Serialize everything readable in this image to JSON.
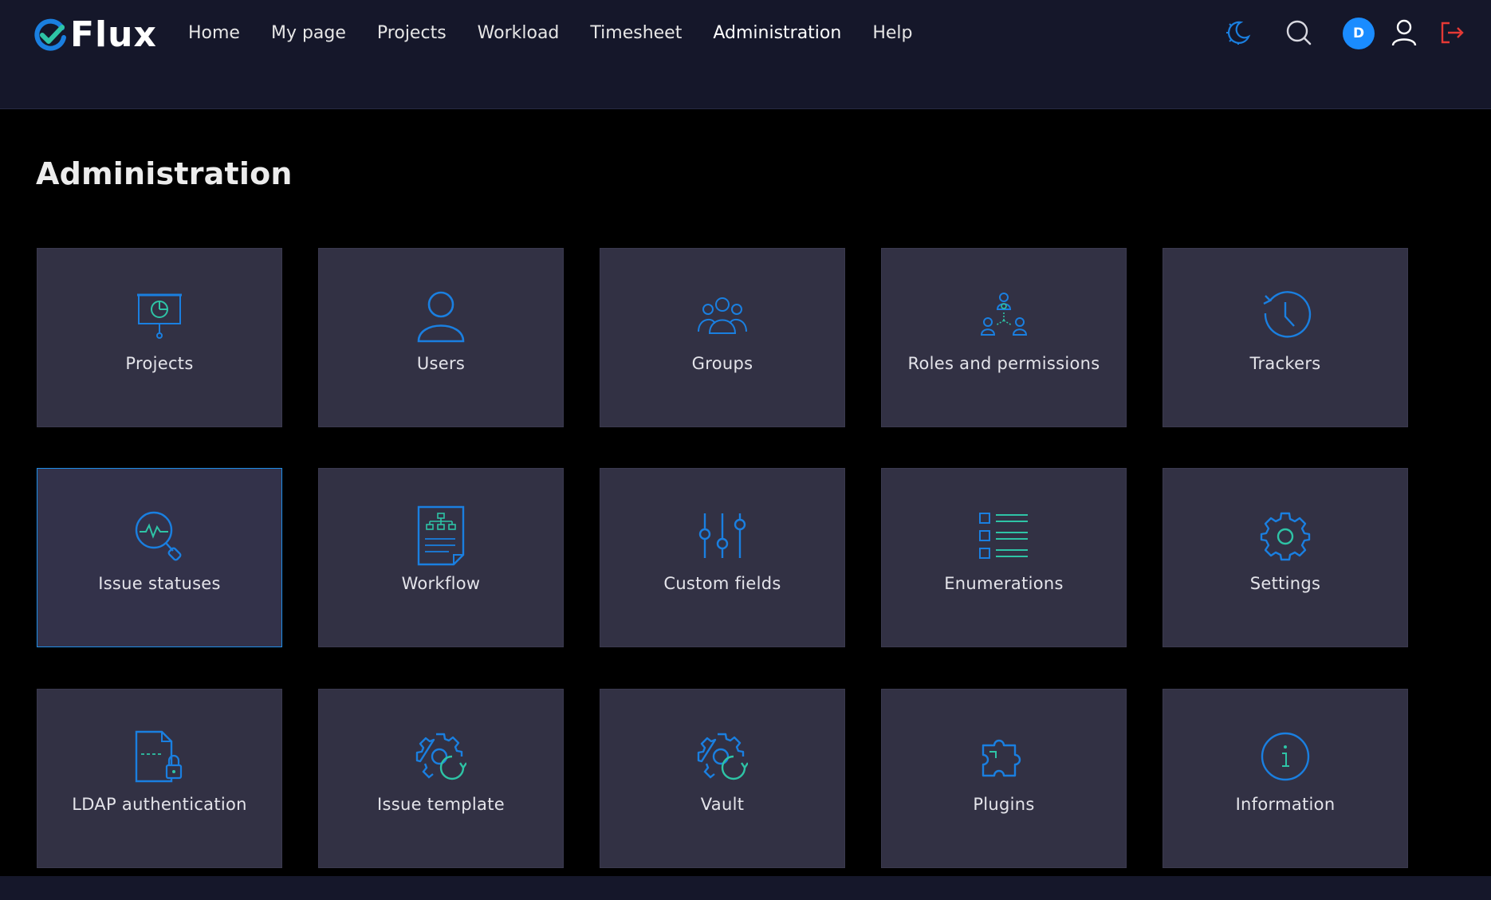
{
  "app": {
    "name": "Flux"
  },
  "nav": {
    "items": [
      {
        "label": "Home"
      },
      {
        "label": "My page"
      },
      {
        "label": "Projects"
      },
      {
        "label": "Workload"
      },
      {
        "label": "Timesheet"
      },
      {
        "label": "Administration",
        "active": true
      },
      {
        "label": "Help"
      }
    ]
  },
  "topbar": {
    "icons": [
      "theme-toggle-icon",
      "search-icon",
      "user-icon",
      "logout-icon"
    ],
    "avatar_initial": "D"
  },
  "colors": {
    "accent": "#1f8ee8",
    "icon_blue": "#1a7fe0",
    "icon_green": "#2ec4a6",
    "logout_red": "#e53935",
    "card_bg": "#323144",
    "topbar_bg": "#15172a"
  },
  "page": {
    "title": "Administration"
  },
  "cards": [
    {
      "label": "Projects",
      "icon": "presentation-board-icon"
    },
    {
      "label": "Users",
      "icon": "user-icon"
    },
    {
      "label": "Groups",
      "icon": "group-icon"
    },
    {
      "label": "Roles and permissions",
      "icon": "roles-icon"
    },
    {
      "label": "Trackers",
      "icon": "clock-history-icon"
    },
    {
      "label": "Issue statuses",
      "icon": "search-pulse-icon",
      "selected": true
    },
    {
      "label": "Workflow",
      "icon": "workflow-document-icon"
    },
    {
      "label": "Custom fields",
      "icon": "sliders-icon"
    },
    {
      "label": "Enumerations",
      "icon": "list-icon"
    },
    {
      "label": "Settings",
      "icon": "gear-icon"
    },
    {
      "label": "LDAP authentication",
      "icon": "locked-file-icon"
    },
    {
      "label": "Issue template",
      "icon": "gear-refresh-icon"
    },
    {
      "label": "Vault",
      "icon": "gear-refresh-icon"
    },
    {
      "label": "Plugins",
      "icon": "puzzle-icon"
    },
    {
      "label": "Information",
      "icon": "info-icon"
    }
  ]
}
